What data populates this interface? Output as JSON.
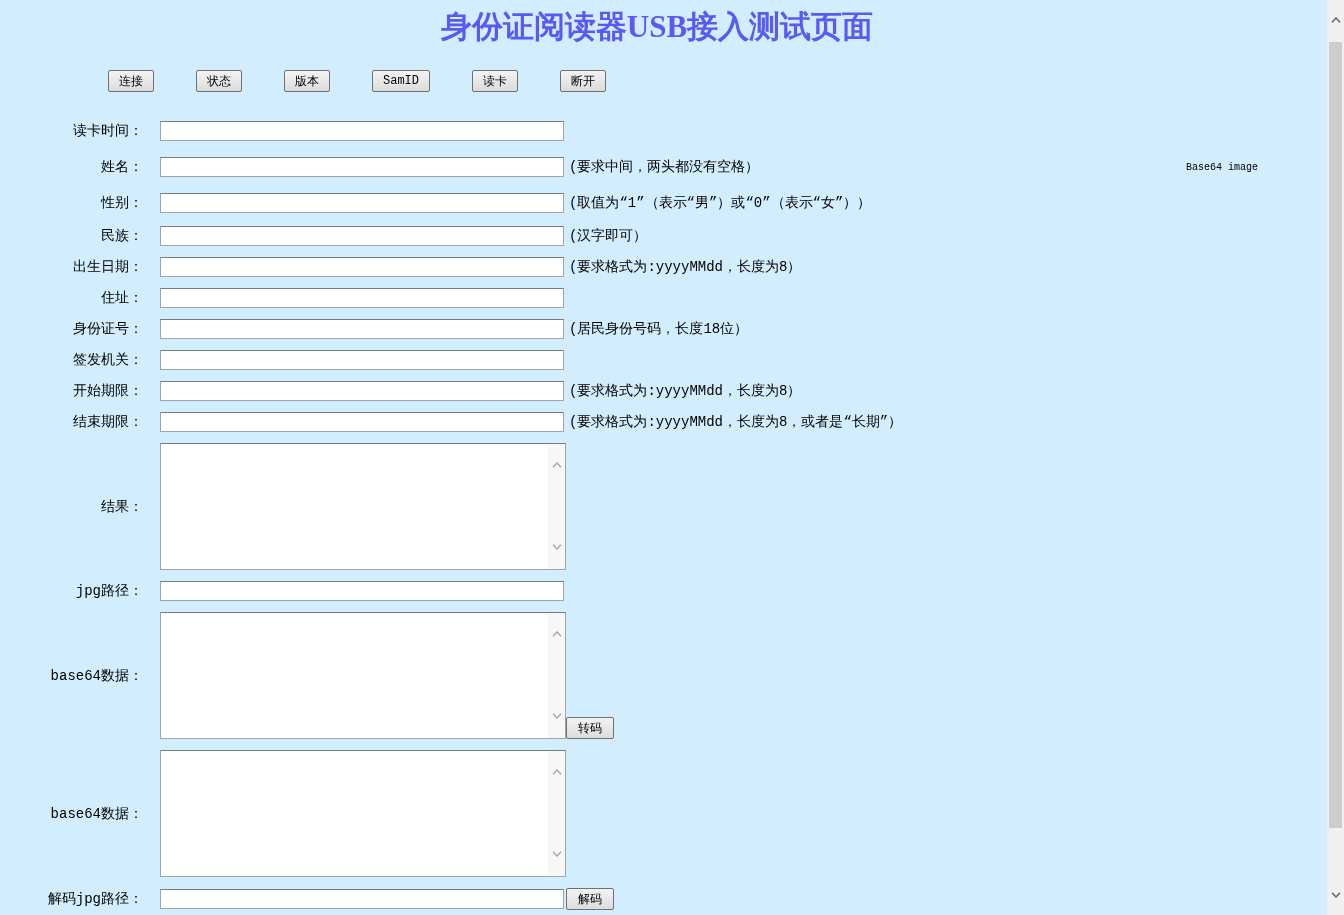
{
  "title": "身份证阅读器USB接入测试页面",
  "toolbar": {
    "buttons": [
      "连接",
      "状态",
      "版本",
      "SamID",
      "读卡",
      "断开"
    ]
  },
  "image": {
    "alt_text": "Base64 image"
  },
  "form": {
    "rows": [
      {
        "kind": "input",
        "label": "读卡时间："
      },
      {
        "kind": "input",
        "label": "姓名：",
        "hint": "(要求中间，两头都没有空格）"
      },
      {
        "kind": "input",
        "label": "性别：",
        "hint": "(取值为“1”（表示“男”）或“0”（表示“女”））"
      },
      {
        "kind": "input",
        "label": "民族：",
        "hint": "(汉字即可）"
      },
      {
        "kind": "input",
        "label": "出生日期：",
        "hint": "(要求格式为:yyyyMMdd，长度为8）"
      },
      {
        "kind": "input",
        "label": "住址："
      },
      {
        "kind": "input",
        "label": "身份证号：",
        "hint": "(居民身份号码，长度18位）"
      },
      {
        "kind": "input",
        "label": "签发机关："
      },
      {
        "kind": "input",
        "label": "开始期限：",
        "hint": "(要求格式为:yyyyMMdd，长度为8）"
      },
      {
        "kind": "input",
        "label": "结束期限：",
        "hint": "(要求格式为:yyyyMMdd，长度为8，或者是“长期”）"
      },
      {
        "kind": "textarea",
        "label": "结果："
      },
      {
        "kind": "input",
        "label": "jpg路径："
      },
      {
        "kind": "textarea",
        "label": "base64数据：",
        "button": "转码"
      },
      {
        "kind": "textarea",
        "label": "base64数据："
      },
      {
        "kind": "input",
        "label": "解码jpg路径：",
        "button": "解码"
      }
    ]
  }
}
